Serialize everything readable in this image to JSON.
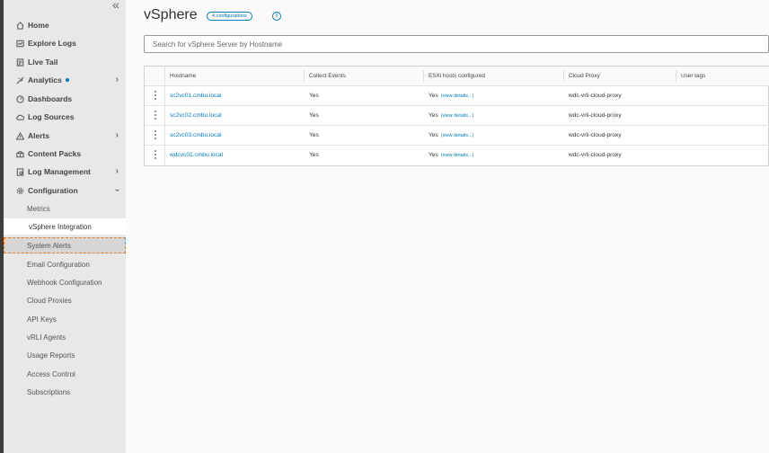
{
  "sidebar": {
    "collapse_glyph": "«",
    "items": [
      {
        "label": "Home",
        "icon": "home-icon"
      },
      {
        "label": "Explore Logs",
        "icon": "explore-logs-icon"
      },
      {
        "label": "Live Tail",
        "icon": "live-tail-icon"
      },
      {
        "label": "Analytics",
        "icon": "analytics-icon"
      },
      {
        "label": "Dashboards",
        "icon": "dashboard-icon"
      },
      {
        "label": "Log Sources",
        "icon": "cloud-icon"
      },
      {
        "label": "Alerts",
        "icon": "alert-icon"
      },
      {
        "label": "Content Packs",
        "icon": "content-packs-icon"
      },
      {
        "label": "Log Management",
        "icon": "log-management-icon"
      },
      {
        "label": "Configuration",
        "icon": "gear-icon"
      }
    ],
    "sub_items": [
      {
        "label": "Metrics"
      },
      {
        "label": "vSphere Integration"
      },
      {
        "label": "System Alerts"
      },
      {
        "label": "Email Configuration"
      },
      {
        "label": "Webhook Configuration"
      },
      {
        "label": "Cloud Proxies"
      },
      {
        "label": "API Keys"
      },
      {
        "label": "vRLI Agents"
      },
      {
        "label": "Usage Reports"
      },
      {
        "label": "Access Control"
      },
      {
        "label": "Subscriptions"
      }
    ]
  },
  "main": {
    "title": "vSphere",
    "badge": "4 configurations",
    "info_glyph": "i",
    "search_placeholder": "Search for vSphere Server by Hostname"
  },
  "table": {
    "headers": [
      "Hostname",
      "Collect Events",
      "ESXi hosts configured",
      "Cloud Proxy",
      "User tags"
    ],
    "rows": [
      {
        "hostname": "sc2vc01.cmbu.local",
        "collect": "Yes",
        "esxi": "Yes",
        "details": "(view details...)",
        "proxy": "wdc-vrli-cloud-proxy",
        "tags": ""
      },
      {
        "hostname": "sc2vc02.cmbu.local",
        "collect": "Yes",
        "esxi": "Yes",
        "details": "(view details...)",
        "proxy": "wdc-vrli-cloud-proxy",
        "tags": ""
      },
      {
        "hostname": "sc2vc03.cmbu.local",
        "collect": "Yes",
        "esxi": "Yes",
        "details": "(view details...)",
        "proxy": "wdc-vrli-cloud-proxy",
        "tags": ""
      },
      {
        "hostname": "wdcvc01.cmbu.local",
        "collect": "Yes",
        "esxi": "Yes",
        "details": "(view details...)",
        "proxy": "wdc-vrli-cloud-proxy",
        "tags": ""
      }
    ]
  },
  "colors": {
    "accent": "#0079b8",
    "sidebar_bg": "#e8e8e8",
    "highlight_outline": "#e07b24"
  }
}
